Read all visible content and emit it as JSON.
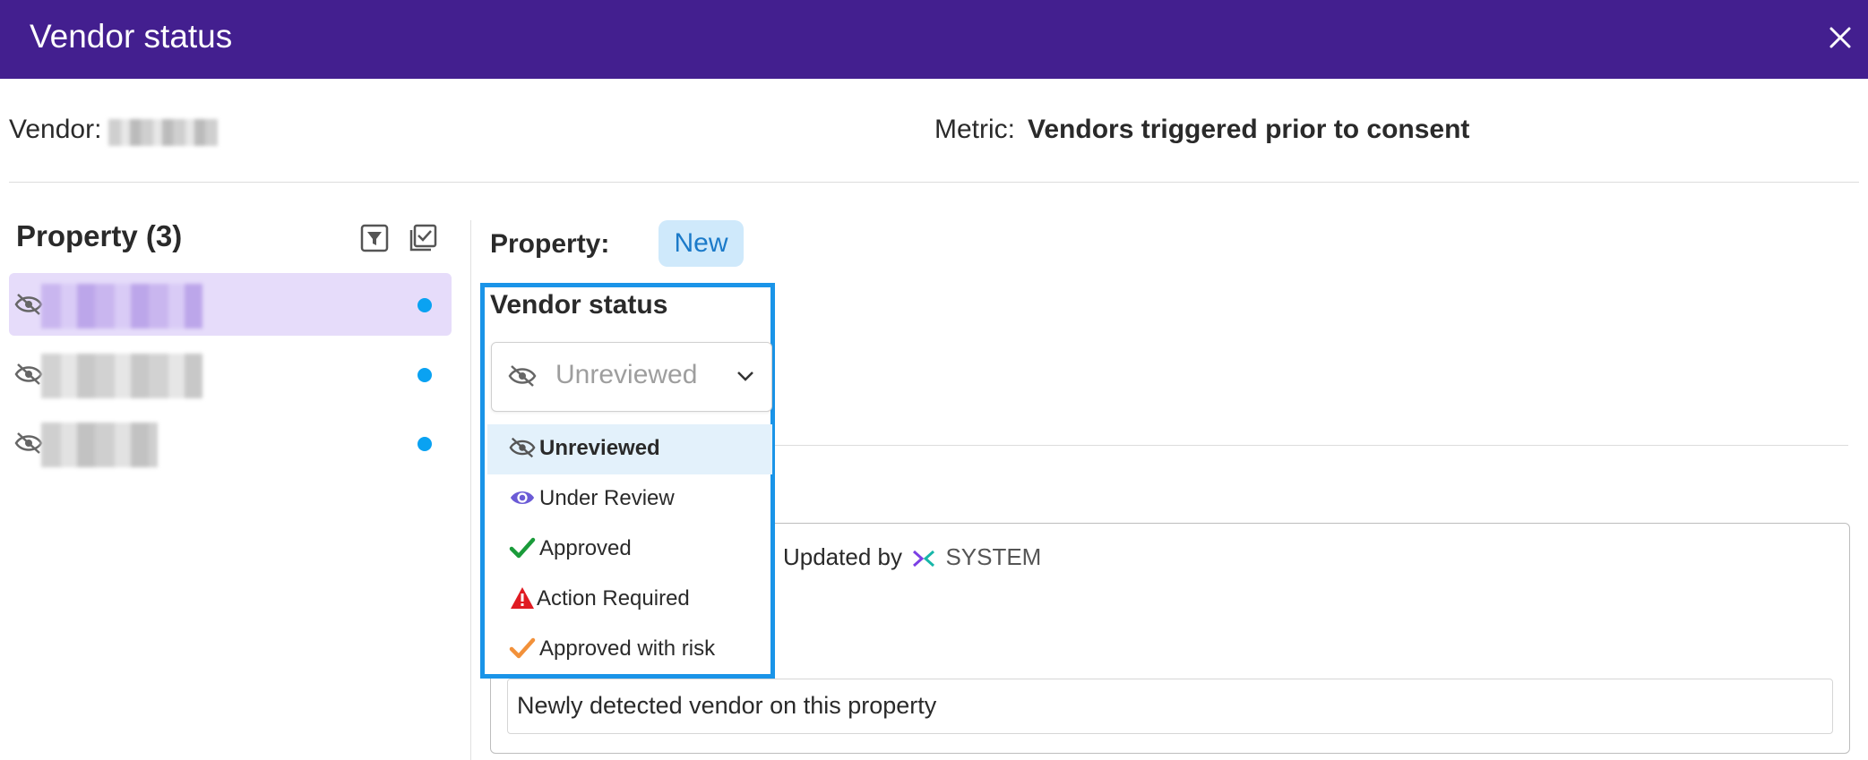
{
  "dialog": {
    "title": "Vendor status"
  },
  "header": {
    "vendor_label": "Vendor:",
    "metric_label": "Metric:",
    "metric_value": "Vendors triggered prior to consent"
  },
  "sidebar": {
    "heading": "Property (3)",
    "items_count": 3
  },
  "detail": {
    "property_label": "Property:",
    "property_badge": "New",
    "vendor_status_label": "Vendor status",
    "selected_status": "Unreviewed",
    "updated_fragment": "| Updated by",
    "updated_by": "SYSTEM",
    "note": "Newly detected vendor on this property"
  },
  "status_menu": {
    "options": [
      {
        "label": "Unreviewed",
        "icon": "eye-slash-icon",
        "color": "#555555"
      },
      {
        "label": "Under Review",
        "icon": "eye-icon",
        "color": "#6b5bd6"
      },
      {
        "label": "Approved",
        "icon": "check-icon",
        "color": "#1a9b3a"
      },
      {
        "label": "Action Required",
        "icon": "warning-triangle-icon",
        "color": "#e01b22"
      },
      {
        "label": "Approved with risk",
        "icon": "check-icon",
        "color": "#f2913a"
      }
    ]
  },
  "colors": {
    "header_bg": "#431f8f",
    "accent": "#1a94e8",
    "dot": "#0aa2f2",
    "selected_row": "#e6dcfa"
  }
}
